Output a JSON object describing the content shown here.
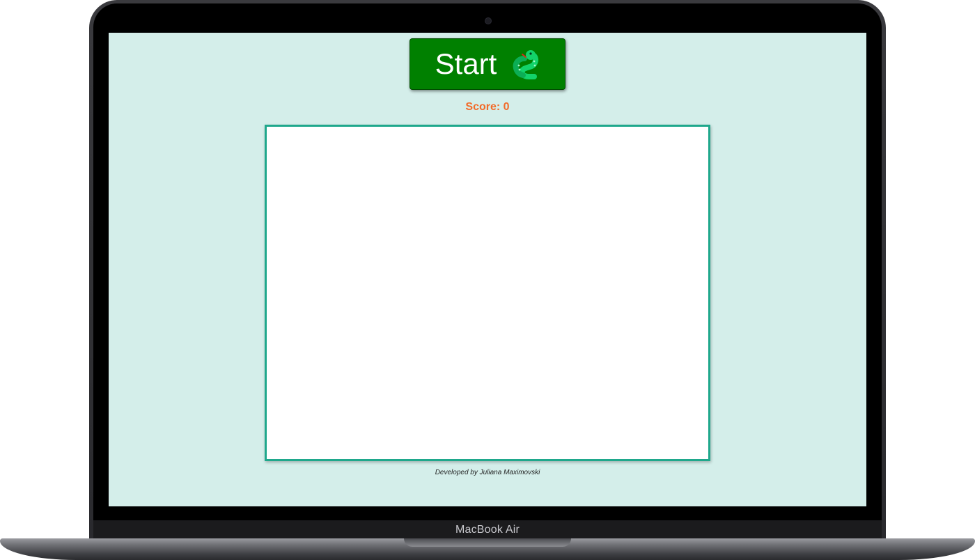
{
  "device": {
    "brand_label": "MacBook Air"
  },
  "app": {
    "start_button_label": "Start",
    "start_button_icon": "snake-icon",
    "score_text": "Score: 0",
    "credit_text": "Developed by Juliana Maximovski"
  },
  "colors": {
    "screen_background": "#d4eeea",
    "start_button": "#008000",
    "score_text": "#f26b2a",
    "board_border": "#1fa88c",
    "board_background": "#ffffff"
  }
}
